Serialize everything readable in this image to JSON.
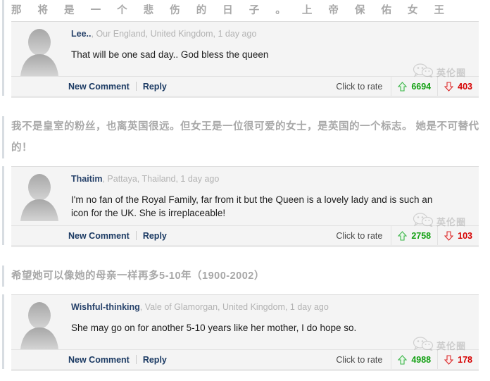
{
  "page": {
    "site_style": "daily-mail-comments",
    "accent_username": "#28436b",
    "accent_link": "#1b3a63",
    "accent_upvote": "#12a012",
    "accent_downvote": "#d60000",
    "accent_muted": "#b3b3b3",
    "block_background": "#f4f4f4"
  },
  "watermark": {
    "icon": "wechat-icon",
    "text": "英伦圈"
  },
  "labels": {
    "new_comment": "New Comment",
    "reply": "Reply",
    "click_to_rate": "Click to rate",
    "upvote_icon": "arrow-up-icon",
    "downvote_icon": "arrow-down-icon",
    "avatar_icon": "user-avatar-placeholder-icon"
  },
  "comments": [
    {
      "translation_cn": "那 将 是 一 个 悲 伤 的 日 子 。 上 帝 保 佑 女 王",
      "translation_spaced": true,
      "translation_wrapped": false,
      "username": "Lee..",
      "location": "Our England, United Kingdom",
      "timestamp": "1 day ago",
      "meta_separator": ", ",
      "text": "That will be one sad day.. God bless the queen",
      "upvotes": "6694",
      "downvotes": "403"
    },
    {
      "translation_cn": "我不是皇室的粉丝，也离英国很远。但女王是一位很可爱的女士，是英国的一个标志。 她是不可替代的！",
      "translation_spaced": false,
      "translation_wrapped": true,
      "username": "Thaitim",
      "location": "Pattaya, Thailand",
      "timestamp": "1 day ago",
      "meta_separator": ", ",
      "text": "I'm no fan of the Royal Family, far from it but the Queen is a lovely lady and is such an icon for the UK. She is irreplaceable!",
      "upvotes": "2758",
      "downvotes": "103"
    },
    {
      "translation_cn": "希望她可以像她的母亲一样再多5-10年（1900-2002）",
      "translation_spaced": false,
      "translation_wrapped": false,
      "username": "Wishful-thinking",
      "location": "Vale of Glamorgan, United Kingdom",
      "timestamp": "1 day ago",
      "meta_separator": ", ",
      "text": "She may go on for another 5-10 years like her mother, I do hope so.",
      "upvotes": "4988",
      "downvotes": "178"
    }
  ]
}
